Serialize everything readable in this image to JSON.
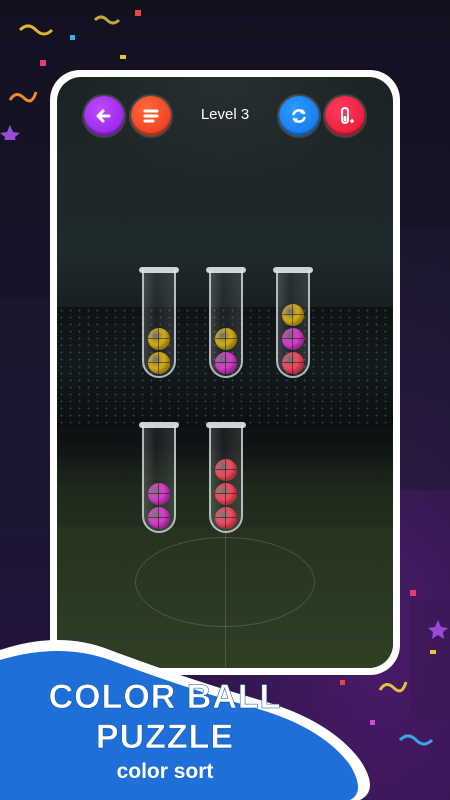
{
  "header": {
    "level_label": "Level 3",
    "buttons": [
      "back",
      "menu",
      "restart",
      "add-tube"
    ]
  },
  "tubes": [
    {
      "id": 1,
      "balls": [
        "yellow",
        "yellow"
      ]
    },
    {
      "id": 2,
      "balls": [
        "yellow",
        "pink"
      ]
    },
    {
      "id": 3,
      "balls": [
        "yellow",
        "pink",
        "red"
      ]
    },
    {
      "id": 4,
      "balls": [
        "pink",
        "pink"
      ]
    },
    {
      "id": 5,
      "balls": [
        "red",
        "red",
        "red"
      ]
    }
  ],
  "ball_colors": {
    "yellow": "#e0b414",
    "pink": "#e23bd6",
    "red": "#ff4a5f"
  },
  "promo": {
    "title_line1": "COLOR BALL",
    "title_line2": "PUZZLE",
    "subtitle": "color sort"
  },
  "accent_colors": {
    "banner_blue": "#1e6fd8",
    "back_btn": "#a52ff0",
    "menu_btn": "#f2452a",
    "restart_btn": "#1f86f5",
    "addtube_btn": "#f0223f"
  }
}
